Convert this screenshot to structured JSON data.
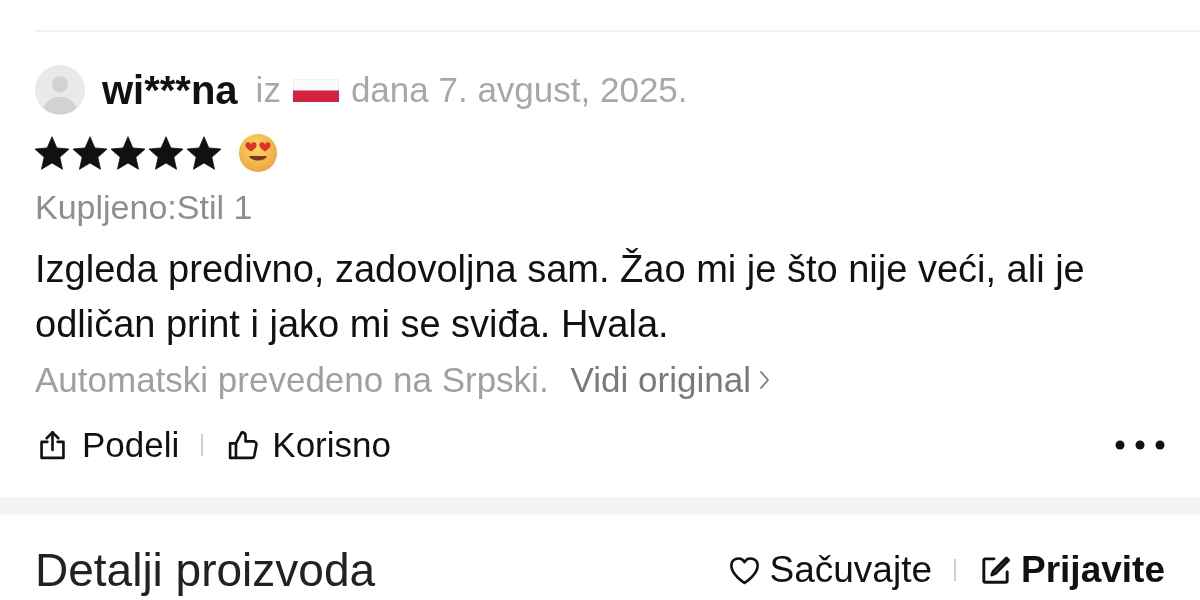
{
  "review": {
    "reviewer": "wi***na",
    "from_label": "iz",
    "date": "dana 7. avgust, 2025.",
    "stars": 5,
    "purchased": "Kupljeno:Stil 1",
    "text": "Izgleda predivno, zadovoljna sam. Žao mi je što nije veći, ali je odličan print i jako mi se sviđa. Hvala.",
    "translation_note": "Automatski prevedeno na Srpski.",
    "original_link": "Vidi original",
    "actions": [
      {
        "kind": "share",
        "label": "Podeli"
      },
      {
        "kind": "helpful",
        "label": "Korisno"
      }
    ]
  },
  "product_details": {
    "title": "Detalji proizvoda",
    "actions": [
      {
        "kind": "save",
        "label": "Sačuvajte"
      },
      {
        "kind": "report",
        "label": "Prijavite"
      }
    ]
  }
}
